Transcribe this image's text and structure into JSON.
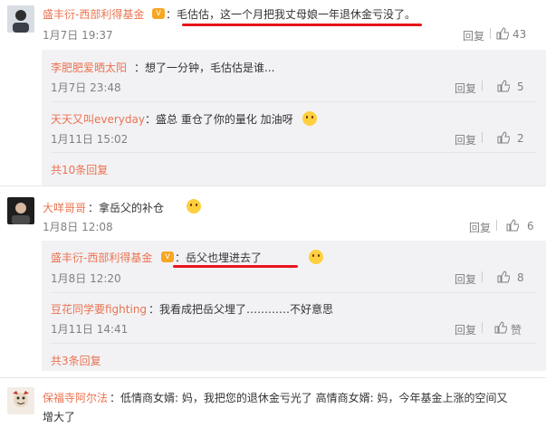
{
  "comments": [
    {
      "name": "盛丰衍-西部利得基金",
      "text": "：毛估估，这一个月把我丈母娘一年退休金亏没了。",
      "time": "1月7日 19:37",
      "reply_label": "回复",
      "likes": "43",
      "replies": [
        {
          "name": "李肥肥爱晒太阳",
          "text": "：想了一分钟，毛估估是谁...",
          "time": "1月7日 23:48",
          "reply_label": "回复",
          "likes": "5"
        },
        {
          "name": "天天又叫everyday",
          "text": "：盛总 重仓了你的量化 加油呀",
          "time": "1月11日 15:02",
          "reply_label": "回复",
          "likes": "2"
        }
      ],
      "more_label": "共10条回复"
    },
    {
      "name": "大咩哥哥",
      "text": "：拿岳父的补仓",
      "time": "1月8日 12:08",
      "reply_label": "回复",
      "likes": "6",
      "replies": [
        {
          "name": "盛丰衍-西部利得基金",
          "text": "：岳父也埋进去了",
          "time": "1月8日 12:20",
          "reply_label": "回复",
          "likes": "8"
        },
        {
          "name": "豆花同学要fighting",
          "text": "：我看成把岳父埋了…………不好意思",
          "time": "1月11日 14:41",
          "reply_label": "回复",
          "likes": "赞"
        }
      ],
      "more_label": "共3条回复"
    },
    {
      "name": "保福寺阿尔法",
      "text": "：低情商女婿: 妈，我把您的退休金亏光了 高情商女婿: 妈，今年基金上涨的空间又",
      "text_line2": "增大了"
    }
  ],
  "colors": {
    "name": "#eb7350",
    "underline": "#e8141b",
    "subpanel": "#f2f2f5",
    "meta": "#808080"
  },
  "icons": {
    "like": "thumbs-up-icon",
    "vip": "vip-badge-icon",
    "emoji": "smiley-emoji-icon"
  }
}
